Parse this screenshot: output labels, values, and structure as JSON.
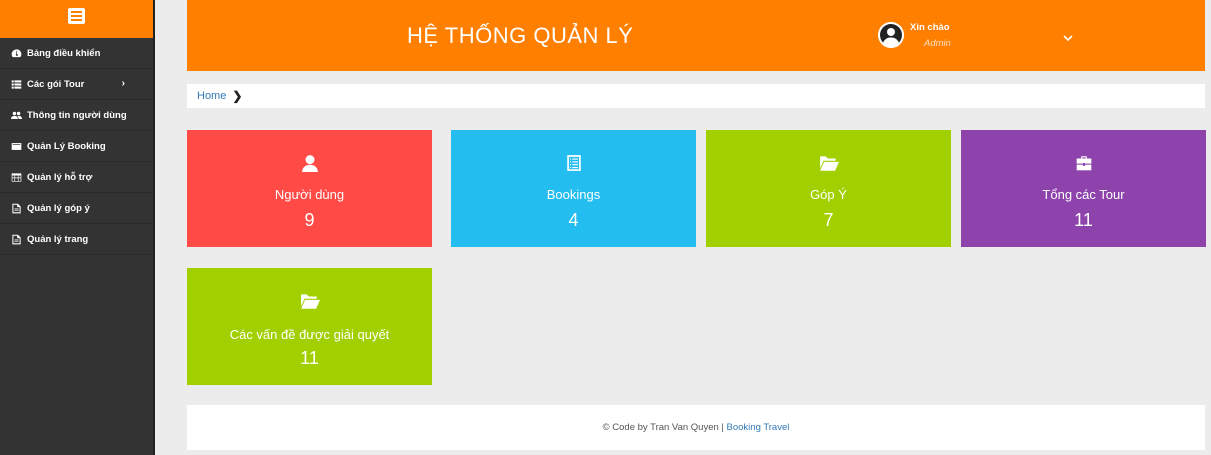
{
  "sidebar": {
    "toggle_icon": "menu-icon",
    "items": [
      {
        "label": "Bảng điều khiển",
        "icon": "dashboard-icon"
      },
      {
        "label": "Các gói Tour",
        "icon": "list-icon",
        "has_submenu": true
      },
      {
        "label": "Thông tin người dùng",
        "icon": "users-icon"
      },
      {
        "label": "Quản Lý Booking",
        "icon": "book-icon"
      },
      {
        "label": "Quản lý hỗ trợ",
        "icon": "table-icon"
      },
      {
        "label": "Quản lý góp ý",
        "icon": "file-icon"
      },
      {
        "label": "Quản lý trang",
        "icon": "file-icon"
      }
    ]
  },
  "header": {
    "title": "HỆ THỐNG QUẢN LÝ",
    "greeting": "Xin chào",
    "user_role": "Admin"
  },
  "breadcrumb": {
    "home": "Home",
    "separator": "❯"
  },
  "cards": [
    {
      "label": "Người dùng",
      "value": "9",
      "icon": "user-icon",
      "color": "#ff4a46"
    },
    {
      "label": "Bookings",
      "value": "4",
      "icon": "list-alt-icon",
      "color": "#23bdef"
    },
    {
      "label": "Góp Ý",
      "value": "7",
      "icon": "folder-open-icon",
      "color": "#a1cf00"
    },
    {
      "label": "Tổng các Tour",
      "value": "11",
      "icon": "briefcase-icon",
      "color": "#8d42ac"
    },
    {
      "label": "Các vấn đề được giải quyết",
      "value": "11",
      "icon": "folder-open-icon",
      "color": "#a1cf00"
    }
  ],
  "footer": {
    "text": "© Code by Tran Van Quyen |",
    "link": "Booking Travel"
  },
  "colors": {
    "accent": "#ff7f00",
    "sidebar_bg": "#333333",
    "link": "#337ab7"
  }
}
